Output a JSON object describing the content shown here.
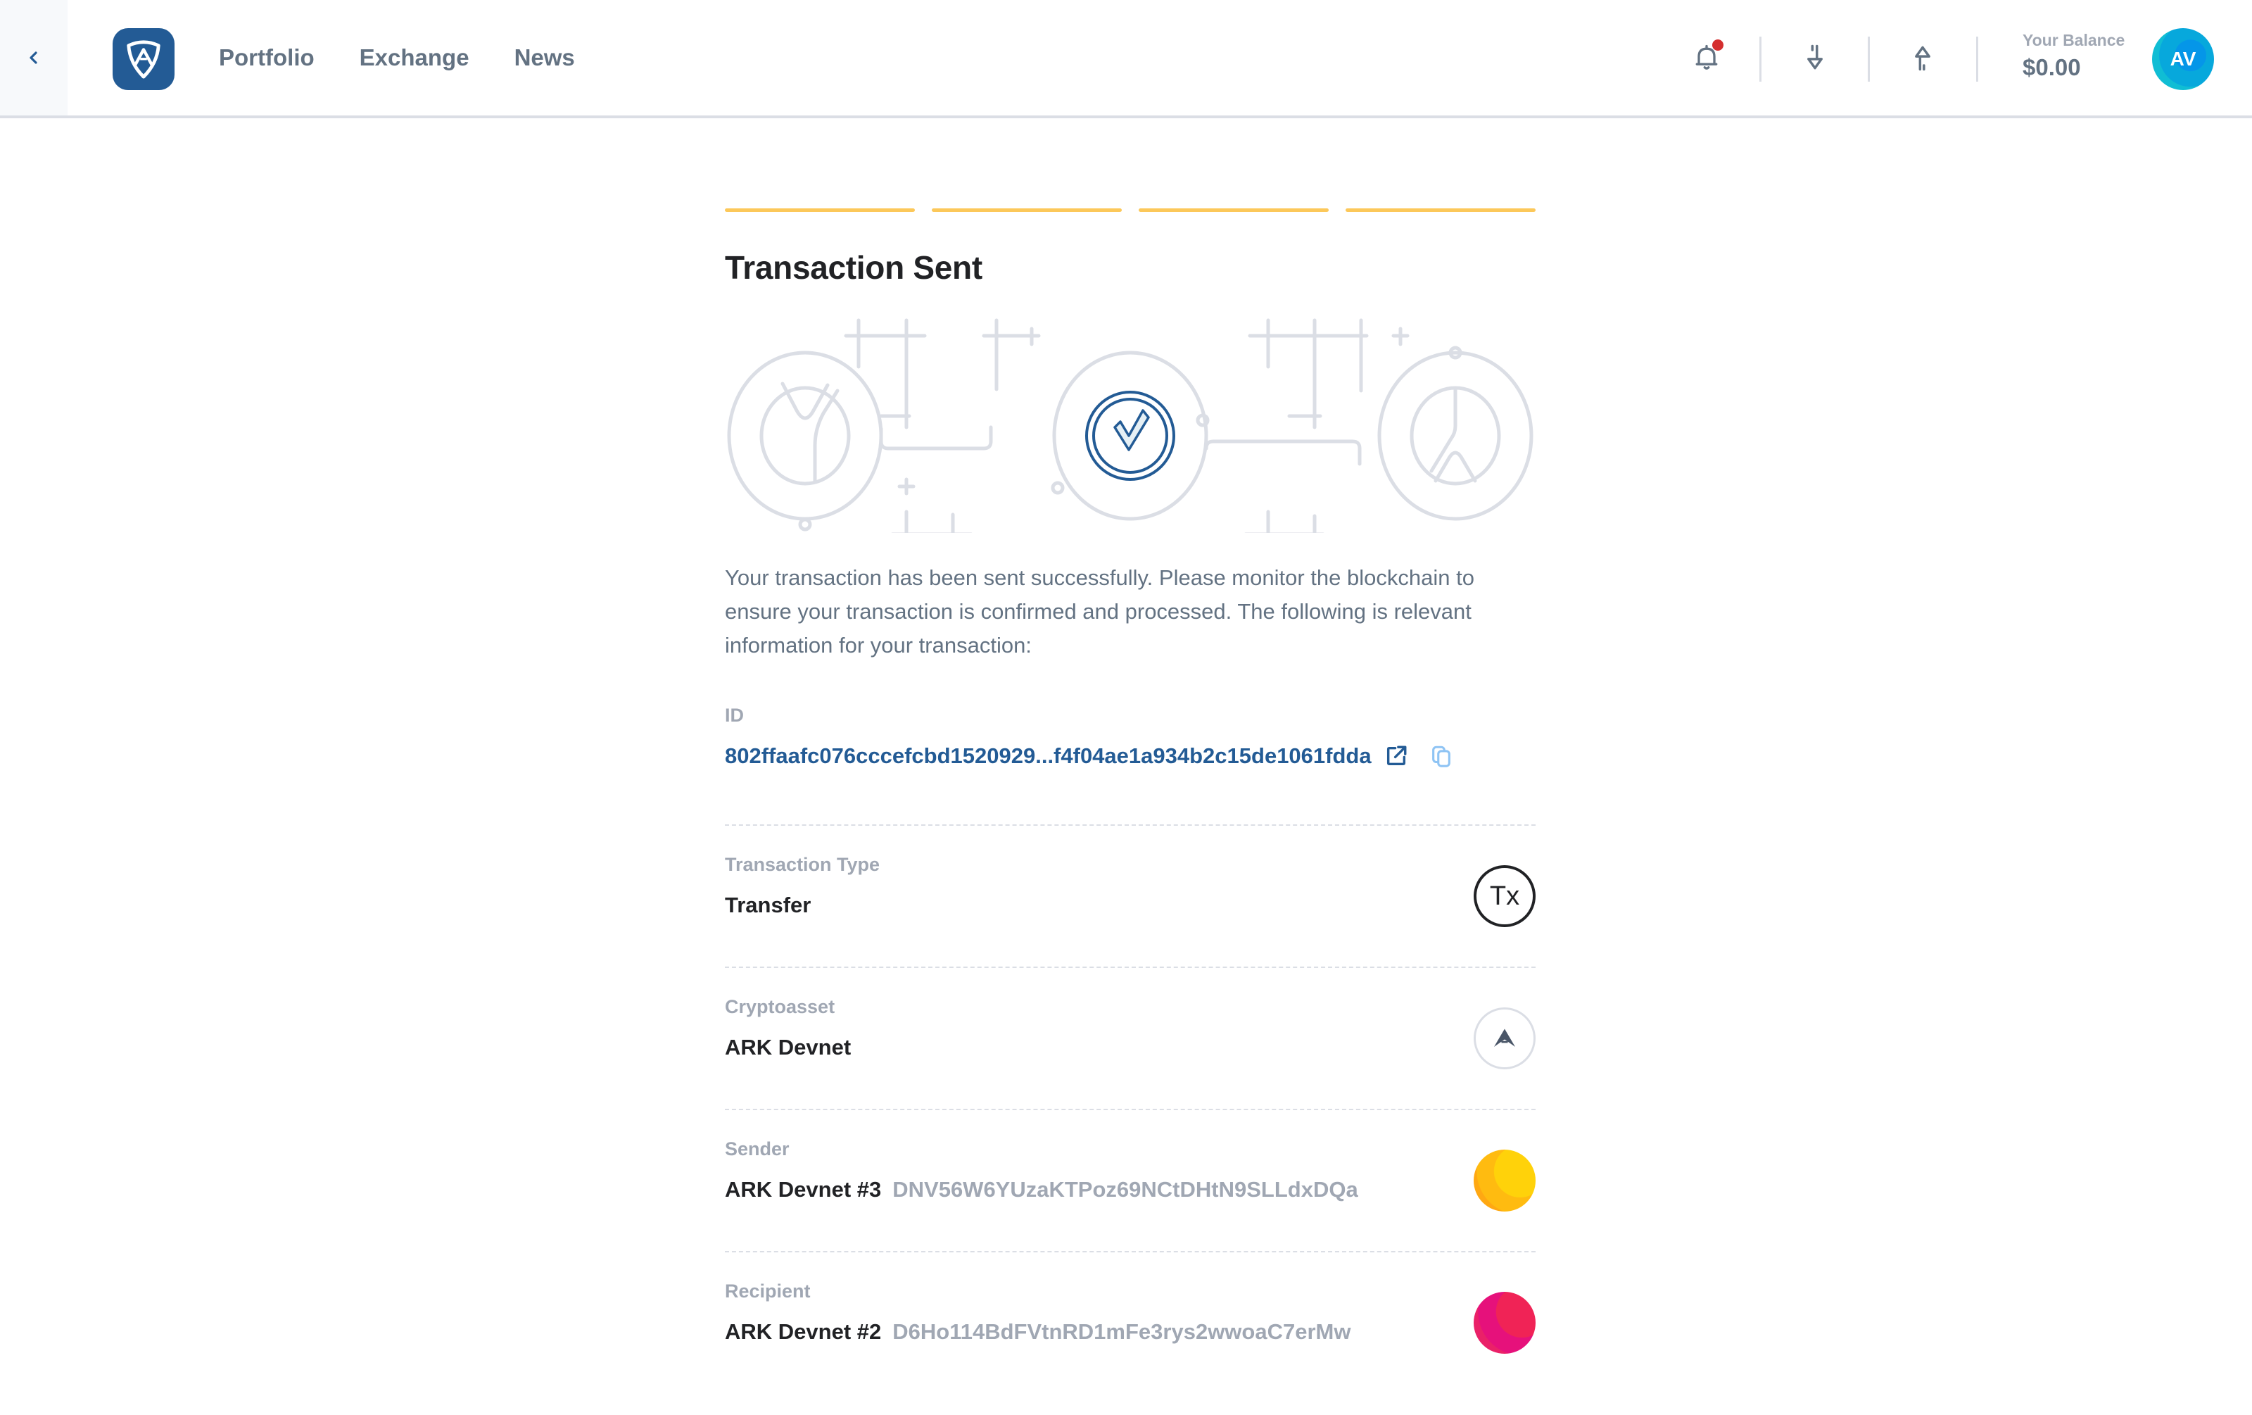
{
  "header": {
    "back_icon": "chevron-left-icon",
    "logo_icon": "ark-shield-logo",
    "nav": [
      {
        "label": "Portfolio"
      },
      {
        "label": "Exchange"
      },
      {
        "label": "News"
      }
    ],
    "icons": {
      "notifications": "bell-icon",
      "receive": "arrow-down-icon",
      "send": "arrow-up-icon"
    },
    "has_notification": true,
    "balance_label": "Your Balance",
    "balance_value": "$0.00",
    "avatar_initials": "AV"
  },
  "colors": {
    "brand": "#235b95",
    "step_active": "#fcc85a",
    "notification": "#d42e2e",
    "label": "#a0a7b3",
    "text_secondary": "#637282",
    "text_primary": "#212225"
  },
  "steps": {
    "total": 4,
    "completed": 4
  },
  "page": {
    "title": "Transaction Sent",
    "description": "Your transaction has been sent successfully. Please monitor the blockchain to ensure your transaction is confirmed and processed. The following is relevant information for your transaction:"
  },
  "details": {
    "id": {
      "label": "ID",
      "value": "802ffaafc076cccefcbd1520929...f4f04ae1a934b2c15de1061fdda",
      "link_icon": "external-link-icon",
      "copy_icon": "copy-icon"
    },
    "type": {
      "label": "Transaction Type",
      "value": "Transfer",
      "icon_text": "Tx"
    },
    "asset": {
      "label": "Cryptoasset",
      "value": "ARK Devnet",
      "icon": "ark-icon"
    },
    "sender": {
      "label": "Sender",
      "name": "ARK Devnet #3",
      "address": "DNV56W6YUzaKTPoz69NCtDHtN9SLLdxDQa"
    },
    "recipient": {
      "label": "Recipient",
      "name": "ARK Devnet #2",
      "address": "D6Ho114BdFVtnRD1mFe3rys2wwoaC7erMw"
    }
  }
}
